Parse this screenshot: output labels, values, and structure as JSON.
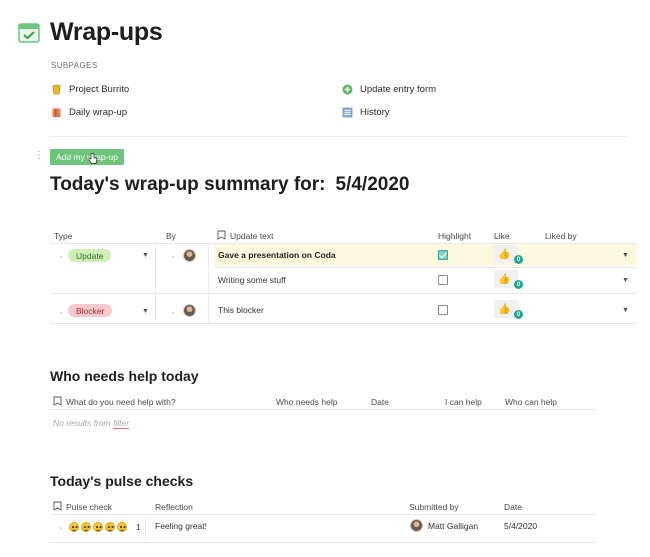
{
  "page": {
    "title": "Wrap-ups",
    "icon": "calendar-check-icon"
  },
  "subpages": {
    "label": "SUBPAGES",
    "items": [
      {
        "label": "Project Burrito",
        "icon": "cup-icon"
      },
      {
        "label": "Daily wrap-up",
        "icon": "book-icon"
      },
      {
        "label": "Update entry form",
        "icon": "plus-circle-icon"
      },
      {
        "label": "History",
        "icon": "ledger-icon"
      }
    ]
  },
  "add_button": {
    "label": "Add my wrap-up"
  },
  "summary": {
    "title": "Today's wrap-up summary for:",
    "date": "5/4/2020"
  },
  "wrapups_table": {
    "columns": {
      "type": "Type",
      "by": "By",
      "update_text": "Update text",
      "highlight": "Highlight",
      "like": "Like",
      "liked_by": "Liked by"
    },
    "groups": [
      {
        "type": "Update",
        "rows": [
          {
            "text": "Gave a presentation on Coda",
            "highlight": true,
            "likes": "0"
          },
          {
            "text": "Writing some stuff",
            "highlight": false,
            "likes": "0"
          }
        ]
      },
      {
        "type": "Blocker",
        "rows": [
          {
            "text": "This blocker",
            "highlight": false,
            "likes": "0"
          }
        ]
      }
    ]
  },
  "help_section": {
    "title": "Who needs help today",
    "columns": {
      "question": "What do you need help with?",
      "who": "Who needs help",
      "date": "Date",
      "can_help": "I can help",
      "who_can_help": "Who can help"
    },
    "empty": {
      "prefix": "No results from",
      "link": "filter"
    }
  },
  "pulse_section": {
    "title": "Today's pulse checks",
    "columns": {
      "pulse": "Pulse check",
      "reflection": "Reflection",
      "submitted_by": "Submitted by",
      "date": "Date"
    },
    "rows": [
      {
        "pulse_value": "1",
        "reflection": "Feeling great!",
        "submitted_by": "Matt Galligan",
        "date": "5/4/2020"
      }
    ]
  },
  "colors": {
    "accent_green": "#6dc57c",
    "update_pill": "#cdeeb7",
    "blocker_pill": "#f8c9cc",
    "highlight_row": "#fdf9de",
    "like_badge": "#27a38f"
  }
}
